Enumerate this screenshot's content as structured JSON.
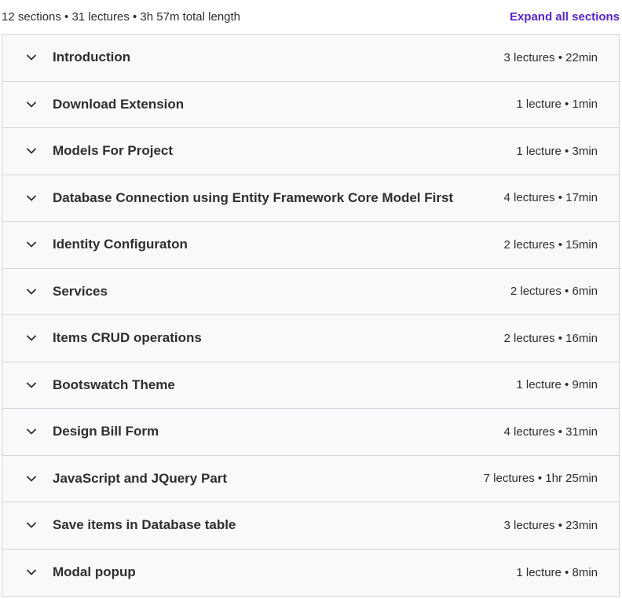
{
  "curriculum": {
    "summary": "12 sections • 31 lectures • 3h 57m total length",
    "expand_all_label": "Expand all sections",
    "sections": [
      {
        "title": "Introduction",
        "meta": "3 lectures • 22min"
      },
      {
        "title": "Download Extension",
        "meta": "1 lecture • 1min"
      },
      {
        "title": "Models For Project",
        "meta": "1 lecture • 3min"
      },
      {
        "title": "Database Connection using Entity Framework Core Model First",
        "meta": "4 lectures • 17min"
      },
      {
        "title": "Identity Configuraton",
        "meta": "2 lectures • 15min"
      },
      {
        "title": "Services",
        "meta": "2 lectures • 6min"
      },
      {
        "title": "Items CRUD operations",
        "meta": "2 lectures • 16min"
      },
      {
        "title": "Bootswatch Theme",
        "meta": "1 lecture • 9min"
      },
      {
        "title": "Design Bill Form",
        "meta": "4 lectures • 31min"
      },
      {
        "title": "JavaScript and JQuery Part",
        "meta": "7 lectures • 1hr 25min"
      },
      {
        "title": "Save items in Database table",
        "meta": "3 lectures • 23min"
      },
      {
        "title": "Modal popup",
        "meta": "1 lecture • 8min"
      }
    ]
  },
  "icons": {
    "section_toggle": "chevron-down-icon"
  },
  "colors": {
    "accent": "#5624d0",
    "row_background": "#f7f9fa",
    "border": "#d1d7dc",
    "text": "#2d2f31"
  }
}
